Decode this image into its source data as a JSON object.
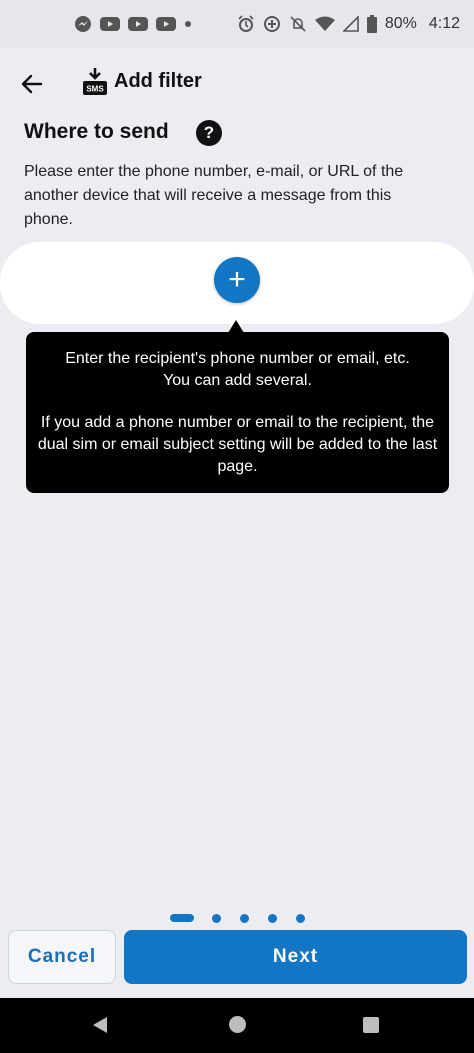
{
  "status_bar": {
    "notification_icons": [
      "messenger-icon",
      "youtube-icon",
      "youtube-icon",
      "youtube-icon",
      "dot-icon"
    ],
    "system_icons": [
      "alarm-icon",
      "data-saver-icon",
      "mute-icon",
      "wifi-icon",
      "signal-icon",
      "battery-icon"
    ],
    "battery": "80%",
    "time": "4:12"
  },
  "app_bar": {
    "title": "Add filter",
    "icon_badge": "SMS"
  },
  "section": {
    "heading": "Where to send",
    "help_glyph": "?",
    "description": "Please enter the phone number, e-mail, or URL of the another device that will receive a message from this phone."
  },
  "recipients": {
    "add_glyph": "+"
  },
  "tooltip": {
    "line1": "Enter the recipient's phone number or email, etc.",
    "line2": "You can add several.",
    "line3": "If you add a phone number or email to the recipient, the dual sim or email subject setting will be added to the last page."
  },
  "pager": {
    "total": 5,
    "current": 1
  },
  "buttons": {
    "cancel": "Cancel",
    "next": "Next"
  },
  "colors": {
    "accent": "#1276c4",
    "background": "#ecedf2",
    "tooltip_bg": "#000000"
  }
}
